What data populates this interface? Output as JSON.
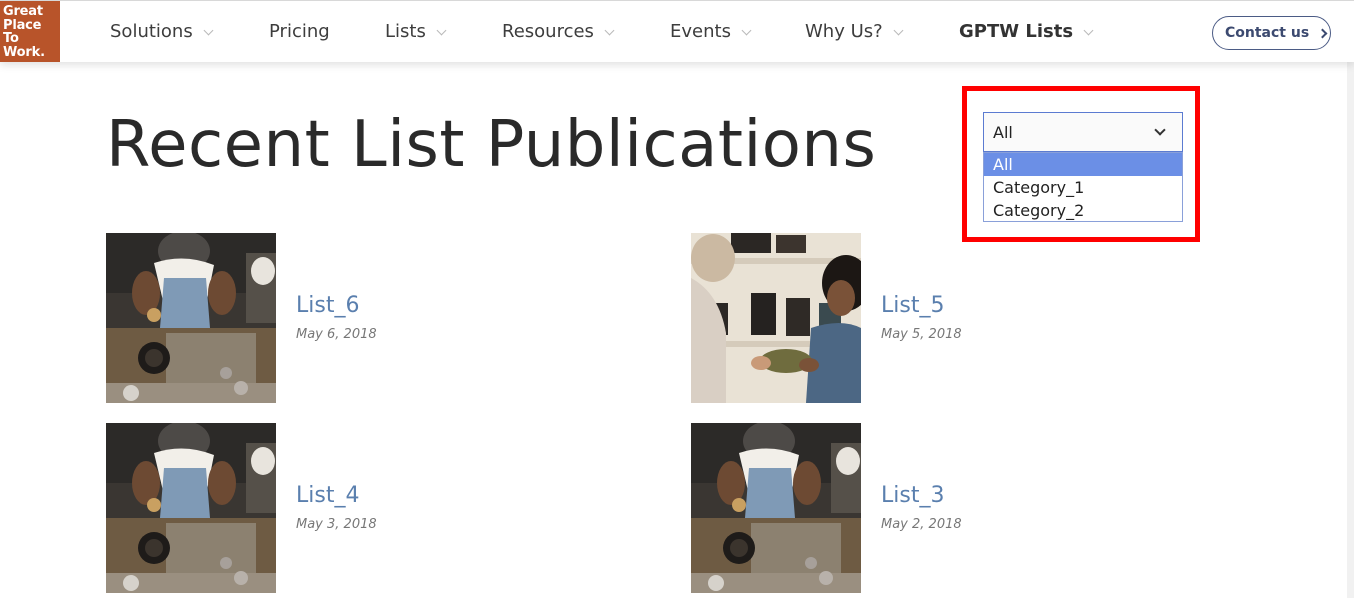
{
  "logo": {
    "lines": [
      "Great",
      "Place",
      "To",
      "Work."
    ]
  },
  "nav": [
    {
      "label": "Solutions",
      "has_dropdown": true
    },
    {
      "label": "Pricing",
      "has_dropdown": false
    },
    {
      "label": "Lists",
      "has_dropdown": true
    },
    {
      "label": "Resources",
      "has_dropdown": true
    },
    {
      "label": "Events",
      "has_dropdown": true
    },
    {
      "label": "Why Us?",
      "has_dropdown": true
    },
    {
      "label": "GPTW Lists",
      "has_dropdown": true
    }
  ],
  "contact_label": "Contact us",
  "page_title": "Recent List Publications",
  "filter": {
    "selected": "All",
    "options": [
      "All",
      "Category_1",
      "Category_2"
    ],
    "highlighted_option": "All"
  },
  "lists": [
    {
      "title": "List_6",
      "date": "May 6, 2018",
      "image": "barista-photo"
    },
    {
      "title": "List_5",
      "date": "May 5, 2018",
      "image": "shoe-store-photo"
    },
    {
      "title": "List_4",
      "date": "May 3, 2018",
      "image": "barista-photo"
    },
    {
      "title": "List_3",
      "date": "May 2, 2018",
      "image": "barista-photo"
    }
  ],
  "colors": {
    "logo_bg": "#b8542a",
    "link": "#5a7fae",
    "highlight_border": "#ff0000",
    "option_selected": "#6b8fe6"
  }
}
